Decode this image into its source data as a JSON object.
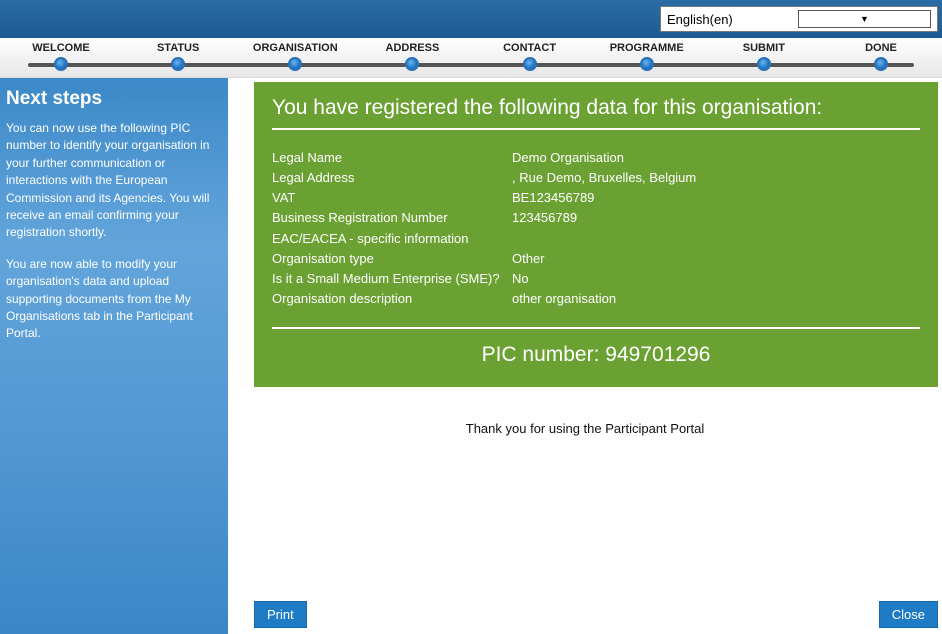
{
  "language": {
    "selected": "English(en)"
  },
  "wizard": {
    "steps": [
      {
        "label": "WELCOME"
      },
      {
        "label": "STATUS"
      },
      {
        "label": "ORGANISATION"
      },
      {
        "label": "ADDRESS"
      },
      {
        "label": "CONTACT"
      },
      {
        "label": "PROGRAMME"
      },
      {
        "label": "SUBMIT"
      },
      {
        "label": "DONE"
      }
    ]
  },
  "sidebar": {
    "title": "Next steps",
    "p1": "You can now use the following PIC number to identify your organisation in your further communication or interactions with the European Commission and its Agencies. You will receive an email confirming your registration shortly.",
    "p2": "You are now able to modify your organisation's data and upload supporting documents from the My Organisations tab in the Participant Portal."
  },
  "summary": {
    "heading": "You have registered the following data for this organisation:",
    "fields": {
      "legal_name_label": "Legal Name",
      "legal_name_value": "Demo Organisation",
      "legal_address_label": "Legal Address",
      "legal_address_value": ", Rue Demo, Bruxelles, Belgium",
      "vat_label": "VAT",
      "vat_value": "BE123456789",
      "brn_label": "Business Registration Number",
      "brn_value": "123456789",
      "eac_label": "EAC/EACEA - specific information",
      "org_type_label": "Organisation type",
      "org_type_value": "Other",
      "sme_label": "Is it a Small Medium Enterprise (SME)?",
      "sme_value": "No",
      "desc_label": "Organisation description",
      "desc_value": "other organisation"
    },
    "pic_label": "PIC number:",
    "pic_value": "949701296",
    "thankyou": "Thank you for using the Participant Portal"
  },
  "buttons": {
    "print": "Print",
    "close": "Close"
  }
}
